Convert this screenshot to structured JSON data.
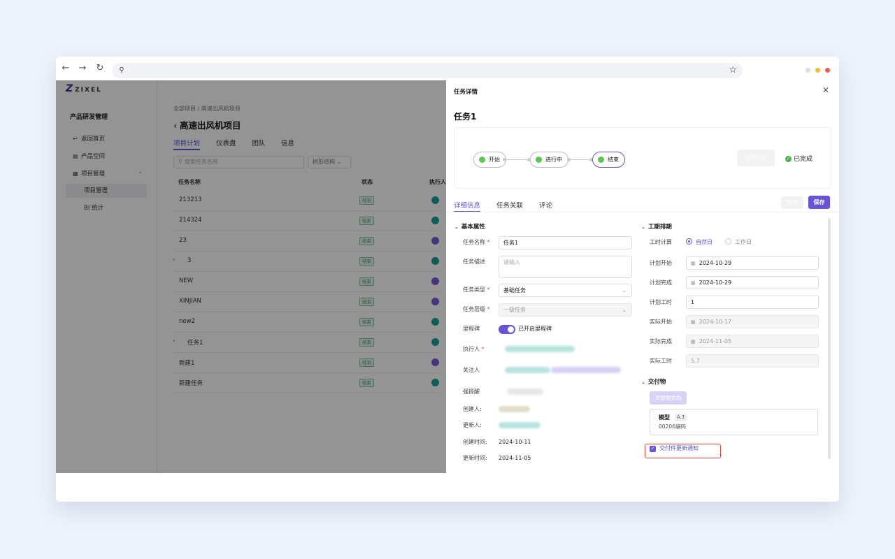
{
  "browser": {
    "back": "←",
    "forward": "→",
    "reload": "↻",
    "site_icon": "⚲",
    "star": "☆",
    "dots": [
      "#dcdcdc",
      "#f5bd2e",
      "#ee5b55"
    ]
  },
  "sidebar": {
    "logo_mark": "Z",
    "logo_text": "ZIXEL",
    "title": "产品研发管理",
    "items": [
      {
        "label": "返回首页",
        "icon": "↩"
      },
      {
        "label": "产品空间",
        "icon": "▤"
      },
      {
        "label": "项目管理",
        "icon": "▦",
        "caret": "⌃"
      }
    ],
    "subitems": [
      "项目管理",
      "BI 统计"
    ]
  },
  "main": {
    "breadcrumb": "全部项目 / 高速出风机项目",
    "title_arrow": "‹",
    "title": "高速出风机项目",
    "tabs": [
      "项目计划",
      "仪表盘",
      "团队",
      "信息"
    ],
    "search_placeholder": "搜索任务名称",
    "tree_select": "树形结构",
    "tree_caret": "⌄",
    "columns": [
      "任务名称",
      "状态",
      "执行人"
    ],
    "rows": [
      {
        "name": "213213",
        "status": "结束",
        "expand": "",
        "avatar": "#18a09a"
      },
      {
        "name": "214324",
        "status": "结束",
        "expand": "",
        "avatar": "#18a09a"
      },
      {
        "name": "23",
        "status": "结束",
        "expand": "",
        "avatar": "#7b5bd6"
      },
      {
        "name": "3",
        "status": "结束",
        "expand": "›",
        "avatar": "#18a09a"
      },
      {
        "name": "NEW",
        "status": "结束",
        "expand": "",
        "avatar": "#7b5bd6"
      },
      {
        "name": "XINJIAN",
        "status": "结束",
        "expand": "",
        "avatar": "#7b5bd6"
      },
      {
        "name": "new2",
        "status": "结束",
        "expand": "",
        "avatar": "#18a09a"
      },
      {
        "name": "任务1",
        "status": "结束",
        "expand": "›",
        "avatar": "#18a09a"
      },
      {
        "name": "新建1",
        "status": "结束",
        "expand": "",
        "avatar": "#7b5bd6"
      },
      {
        "name": "新建任务",
        "status": "结束",
        "expand": "",
        "avatar": "#18a09a"
      }
    ]
  },
  "drawer": {
    "title": "任务详情",
    "close": "✕",
    "task_name": "任务1",
    "flow": [
      "开始",
      "进行中",
      "结束"
    ],
    "rollback": "回退节点",
    "done_check": "✓",
    "done": "已完成",
    "tabs": [
      "详细信息",
      "任务关联",
      "评论"
    ],
    "cancel": "取消",
    "save": "保存",
    "basic": {
      "section": "基本属性",
      "chevron": "⌄",
      "name_label": "任务名称",
      "name_value": "任务1",
      "desc_label": "任务描述",
      "desc_placeholder": "请输入",
      "type_label": "任务类型",
      "type_value": "基础任务",
      "level_label": "任务层级",
      "level_value": "一级任务",
      "milestone_label": "里程碑",
      "milestone_text": "已开启里程碑",
      "assignee_label": "执行人",
      "follower_label": "关注人",
      "remind_label": "强提醒",
      "creator_label": "创建人:",
      "updater_label": "更新人:",
      "created_label": "创建时间:",
      "created_value": "2024-10-11",
      "updated_label": "更新时间:",
      "updated_value": "2024-11-05",
      "required_mark": "*",
      "select_caret": "⌄",
      "cal_icon": "▦"
    },
    "schedule": {
      "section": "工期排期",
      "calc_label": "工时计算",
      "calc_options": [
        "自然日",
        "工作日"
      ],
      "plan_start_label": "计划开始",
      "plan_start": "2024-10-29",
      "plan_end_label": "计划完成",
      "plan_end": "2024-10-29",
      "plan_hours_label": "计划工时",
      "plan_hours": "1",
      "actual_start_label": "实际开始",
      "actual_start": "2024-10-17",
      "actual_end_label": "实际完成",
      "actual_end": "2024-11-05",
      "actual_hours_label": "实际工时",
      "actual_hours": "5.7"
    },
    "deliverable": {
      "section": "交付物",
      "link_btn": "关联图文档",
      "doc_name": "模型",
      "doc_tag": "A.1",
      "doc_code": "00206编码",
      "notify_check": "✓",
      "notify": "交付件更新通知"
    }
  }
}
